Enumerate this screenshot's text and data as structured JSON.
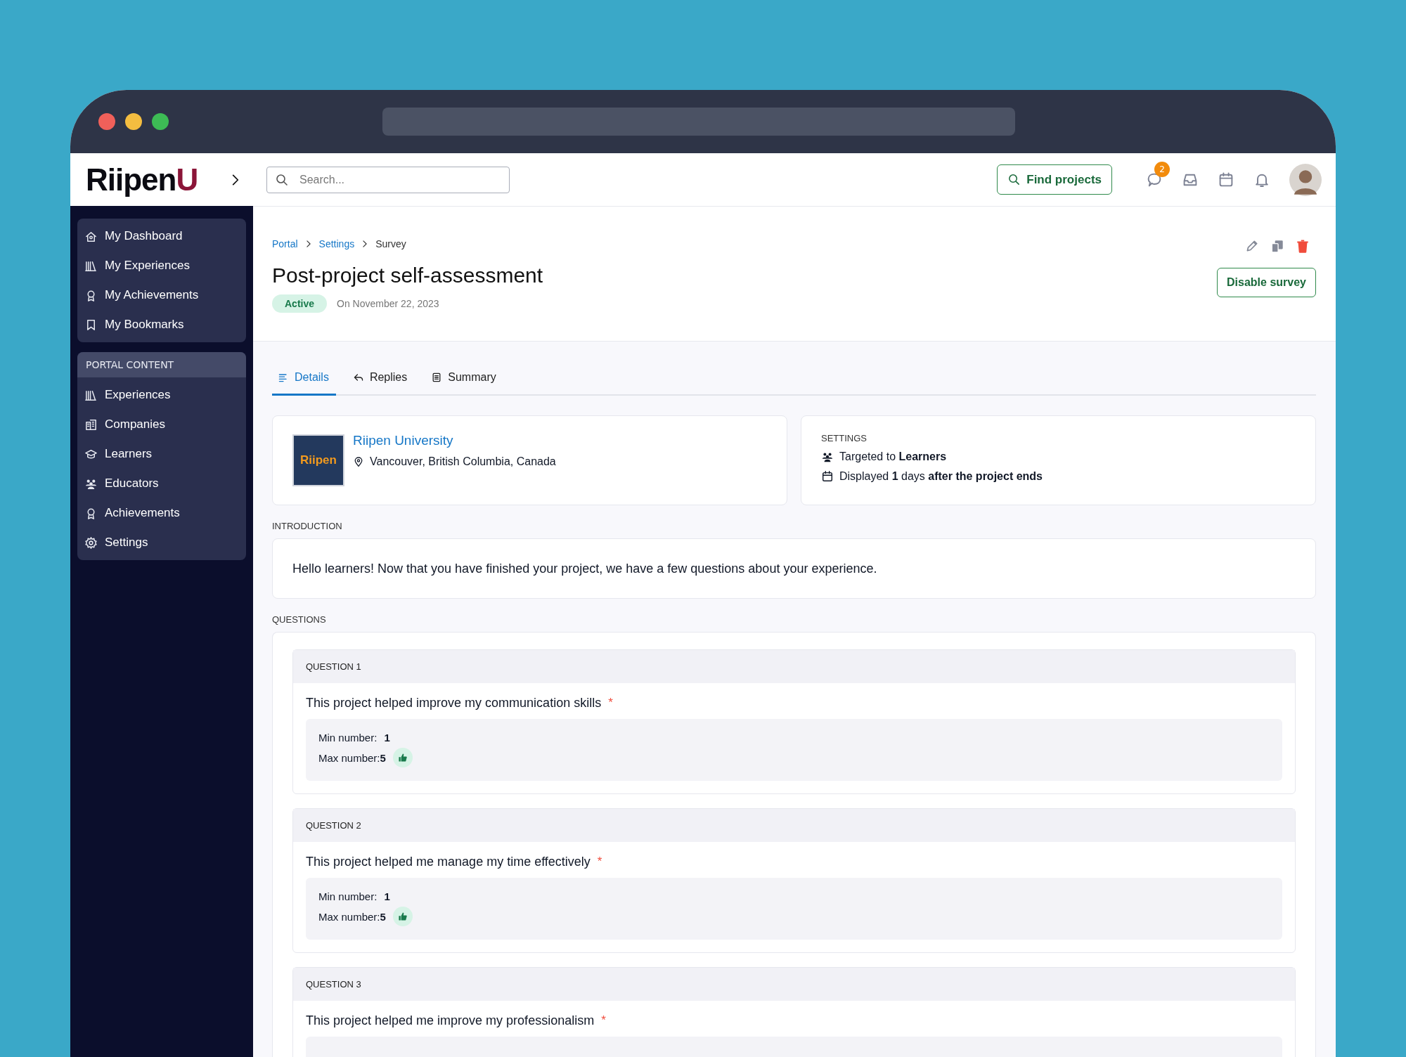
{
  "logo": {
    "text": "Riipen",
    "accent": "U"
  },
  "search": {
    "placeholder": "Search..."
  },
  "topbar": {
    "find_button": "Find projects",
    "message_badge": "2"
  },
  "sidebar": {
    "items": [
      {
        "label": "My Dashboard"
      },
      {
        "label": "My Experiences"
      },
      {
        "label": "My Achievements"
      },
      {
        "label": "My Bookmarks"
      }
    ],
    "sections": [
      {
        "title": "PORTAL CONTENT",
        "items": [
          {
            "label": "Experiences"
          },
          {
            "label": "Companies"
          },
          {
            "label": "Learners"
          },
          {
            "label": "Educators"
          },
          {
            "label": "Achievements"
          },
          {
            "label": "Settings"
          }
        ]
      }
    ]
  },
  "breadcrumb": [
    {
      "label": "Portal",
      "link": true
    },
    {
      "label": "Settings",
      "link": true
    },
    {
      "label": "Survey",
      "link": false
    }
  ],
  "page": {
    "title": "Post-project self-assessment",
    "status": "Active",
    "date": "On November 22, 2023",
    "action_button": "Disable survey"
  },
  "tabs": [
    {
      "label": "Details",
      "selected": true
    },
    {
      "label": "Replies",
      "selected": false
    },
    {
      "label": "Summary",
      "selected": false
    }
  ],
  "organization": {
    "logo_text": "Riipen",
    "name": "Riipen University",
    "location": "Vancouver, British Columbia, Canada"
  },
  "settings": {
    "heading": "SETTINGS",
    "lines": [
      "Targeted to **Learners**",
      "Displayed **1** days **after the project ends**"
    ]
  },
  "introduction": {
    "heading": "INTRODUCTION",
    "text": "Hello learners! Now that you have finished your project, we have a few questions about your experience."
  },
  "questions_heading": "QUESTIONS",
  "questions": [
    {
      "label": "QUESTION 1",
      "text": "This project helped improve my communication skills",
      "required_mark": "*",
      "min": "Min number: **1**",
      "max": "Max number:**5**"
    },
    {
      "label": "QUESTION 2",
      "text": "This project helped me manage my time effectively",
      "required_mark": "*",
      "min": "Min number: **1**",
      "max": "Max number:**5**"
    },
    {
      "label": "QUESTION 3",
      "text": "This project helped me improve my professionalism",
      "required_mark": "*"
    }
  ]
}
